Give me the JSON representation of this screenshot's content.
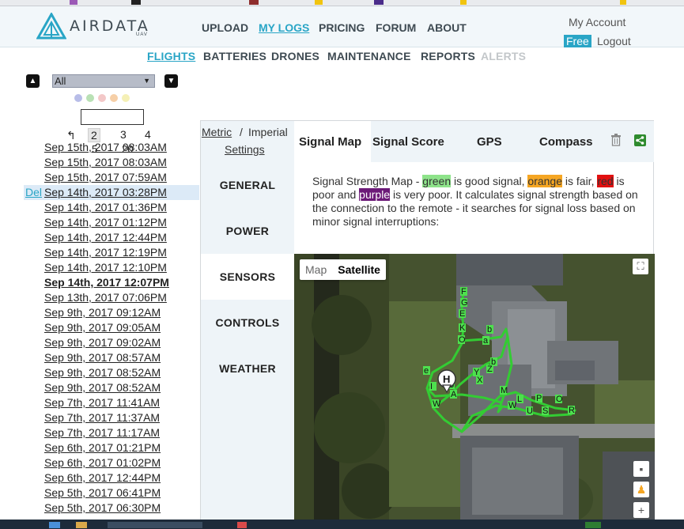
{
  "brand": {
    "name": "AIRDATA",
    "sub": "UAV"
  },
  "top_nav": [
    "UPLOAD",
    "MY LOGS",
    "PRICING",
    "FORUM",
    "ABOUT"
  ],
  "top_nav_active": "MY LOGS",
  "account": {
    "my_account": "My Account",
    "plan": "Free",
    "logout": "Logout"
  },
  "sub_nav": [
    "FLIGHTS",
    "BATTERIES",
    "DRONES",
    "MAINTENANCE",
    "REPORTS",
    "ALERTS"
  ],
  "sub_nav_active": "FLIGHTS",
  "sub_nav_disabled": "ALERTS",
  "filter": {
    "drone_select": "All",
    "search_value": ""
  },
  "filter_dot_colors": [
    "#b8bde8",
    "#b9e1b5",
    "#f3c8c8",
    "#f6cfa7",
    "#f5f0b6"
  ],
  "pager": {
    "back": "↰",
    "pages": [
      "2",
      "3",
      "4"
    ],
    "current": "2",
    "page_sizes": [
      "5",
      "20"
    ]
  },
  "delete_label": "Del",
  "flights": [
    "Sep 15th, 2017 08:03AM",
    "Sep 15th, 2017 08:03AM",
    "Sep 15th, 2017 07:59AM",
    "Sep 14th, 2017 03:28PM",
    "Sep 14th, 2017 01:36PM",
    "Sep 14th, 2017 01:12PM",
    "Sep 14th, 2017 12:44PM",
    "Sep 14th, 2017 12:19PM",
    "Sep 14th, 2017 12:10PM",
    "Sep 14th, 2017 12:07PM",
    "Sep 13th, 2017 07:06PM",
    "Sep 9th, 2017 09:12AM",
    "Sep 9th, 2017 09:05AM",
    "Sep 9th, 2017 09:02AM",
    "Sep 9th, 2017 08:57AM",
    "Sep 9th, 2017 08:52AM",
    "Sep 9th, 2017 08:52AM",
    "Sep 7th, 2017 11:41AM",
    "Sep 7th, 2017 11:37AM",
    "Sep 7th, 2017 11:17AM",
    "Sep 6th, 2017 01:21PM",
    "Sep 6th, 2017 01:02PM",
    "Sep 6th, 2017 12:44PM",
    "Sep 5th, 2017 06:41PM",
    "Sep 5th, 2017 06:30PM"
  ],
  "flight_hover_row": "Sep 14th, 2017 03:28PM",
  "flight_selected": "Sep 14th, 2017 12:07PM",
  "units": {
    "metric": "Metric",
    "separator": "/",
    "imperial": "Imperial",
    "settings": "Settings"
  },
  "tabs": [
    "Signal Map",
    "Signal Score",
    "GPS",
    "Compass"
  ],
  "tab_active": "Signal Map",
  "side_menu": [
    "GENERAL",
    "POWER",
    "SENSORS",
    "CONTROLS",
    "WEATHER"
  ],
  "side_menu_active": "SENSORS",
  "description": {
    "p1": "Signal Strength Map - ",
    "green": "green",
    "p2": " is good signal, ",
    "orange": "orange",
    "p3": " is fair, ",
    "red": "red",
    "p4": " is poor and ",
    "purple": "purple",
    "p5": " is very poor. It calculates signal strength based on the connection to the remote - it searches for signal loss based on minor signal interruptions:"
  },
  "map": {
    "map_label": "Map",
    "satellite_label": "Satellite",
    "active_type": "Satellite",
    "home_marker": "H",
    "path_color": "#33cc33"
  },
  "icons": [
    "airdata-logo-icon",
    "up-arrow-icon",
    "down-arrow-icon",
    "trash-icon",
    "share-icon",
    "fullscreen-icon",
    "home-marker-icon",
    "pegman-icon",
    "zoom-in-icon",
    "map-layers-icon"
  ]
}
